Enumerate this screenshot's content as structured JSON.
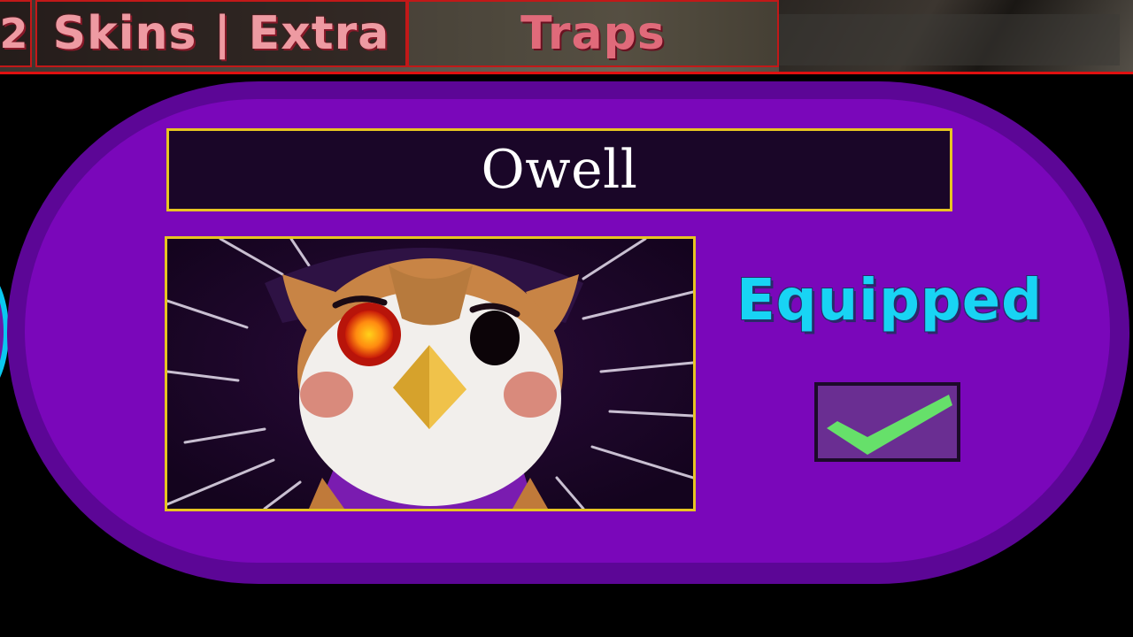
{
  "tabs": [
    {
      "label": "2"
    },
    {
      "label": "Skins | Extra"
    },
    {
      "label": "Traps"
    }
  ],
  "skin": {
    "name": "Owell",
    "status": "Equipped",
    "equipped": true
  },
  "icons": {
    "equip_toggle": "checkmark-icon"
  },
  "colors": {
    "card": "#7a07ba",
    "card_rim": "#5c0696",
    "banner_bg": "#1a0628",
    "frame_gold": "#e6c522",
    "status_cyan": "#18d4f4",
    "check_green": "#66e06a",
    "tab_text": "#ee9aa2",
    "tab_border": "#c21818"
  }
}
